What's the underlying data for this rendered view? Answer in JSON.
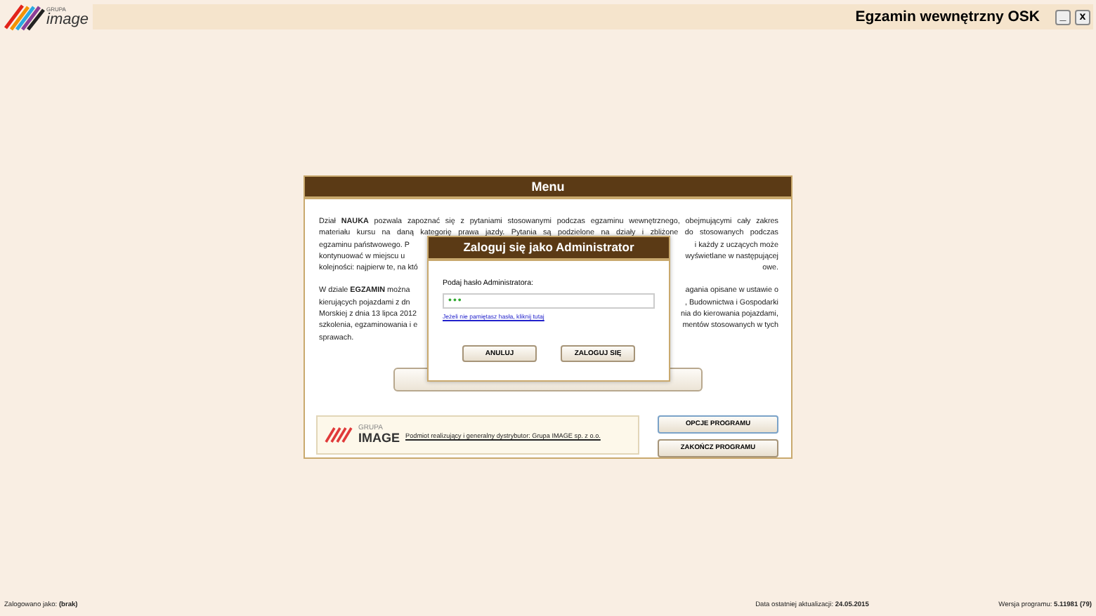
{
  "header": {
    "logo_top": "GRUPA",
    "logo_main": "image",
    "title": "Egzamin wewnętrzny OSK",
    "window_buttons": [
      "_",
      "x"
    ]
  },
  "menu": {
    "title": "Menu",
    "paragraphs": [
      [
        {
          "kind": "full",
          "text": "Dział **NAUKA** pozwala zapoznać się z pytaniami stosowanymi podczas egzaminu wewnętrznego, obejmującymi cały zakres"
        },
        {
          "kind": "full",
          "text": "materiału kursu na daną kategorię prawa jazdy. Pytania są podzielone na działy i zbliżone do stosowanych podczas"
        },
        {
          "kind": "split",
          "left": "egzaminu państwowego. P",
          "right": "i każdy z uczących może"
        },
        {
          "kind": "split",
          "left": "kontynuować w miejscu u",
          "right": "wyświetlane w następującej"
        },
        {
          "kind": "split",
          "left": "kolejności: najpierw te, na któ",
          "right": "owe."
        }
      ],
      [
        {
          "kind": "split",
          "left": "W dziale **EGZAMIN** można",
          "right": "agania opisane w ustawie o"
        },
        {
          "kind": "split",
          "left": "kierujących pojazdami z dn",
          "right": ", Budownictwa i Gospodarki"
        },
        {
          "kind": "split",
          "left": "Morskiej z dnia 13 lipca 2012",
          "right": "nia do kierowania pojazdami,"
        },
        {
          "kind": "split",
          "left": "szkolenia, egzaminowania i e",
          "right": "mentów stosowanych w tych"
        },
        {
          "kind": "last",
          "text": "sprawach."
        }
      ]
    ],
    "brand_top": "GRUPA",
    "brand_main": "IMAGE",
    "distributor": "Podmiot realizujący i generalny dystrybutor: Grupa IMAGE sp. z o.o.",
    "buttons": [
      "OPCJE PROGRAMU",
      "ZAKOŃCZ PROGRAMU"
    ]
  },
  "dialog": {
    "title": "Zaloguj się jako Administrator",
    "label": "Podaj hasło Administratora:",
    "value": "•••",
    "forgot_link": "Jeżeli nie pamiętasz hasła, kliknij tutaj",
    "buttons": [
      "ANULUJ",
      "ZALOGUJ SIĘ"
    ]
  },
  "status_bar": {
    "user": "Zalogowano jako: **(brak)**",
    "updated": "Data ostatniej aktualizacji: **24.05.2015**",
    "version": "Wersja programu: **5.11981 (79)**"
  }
}
